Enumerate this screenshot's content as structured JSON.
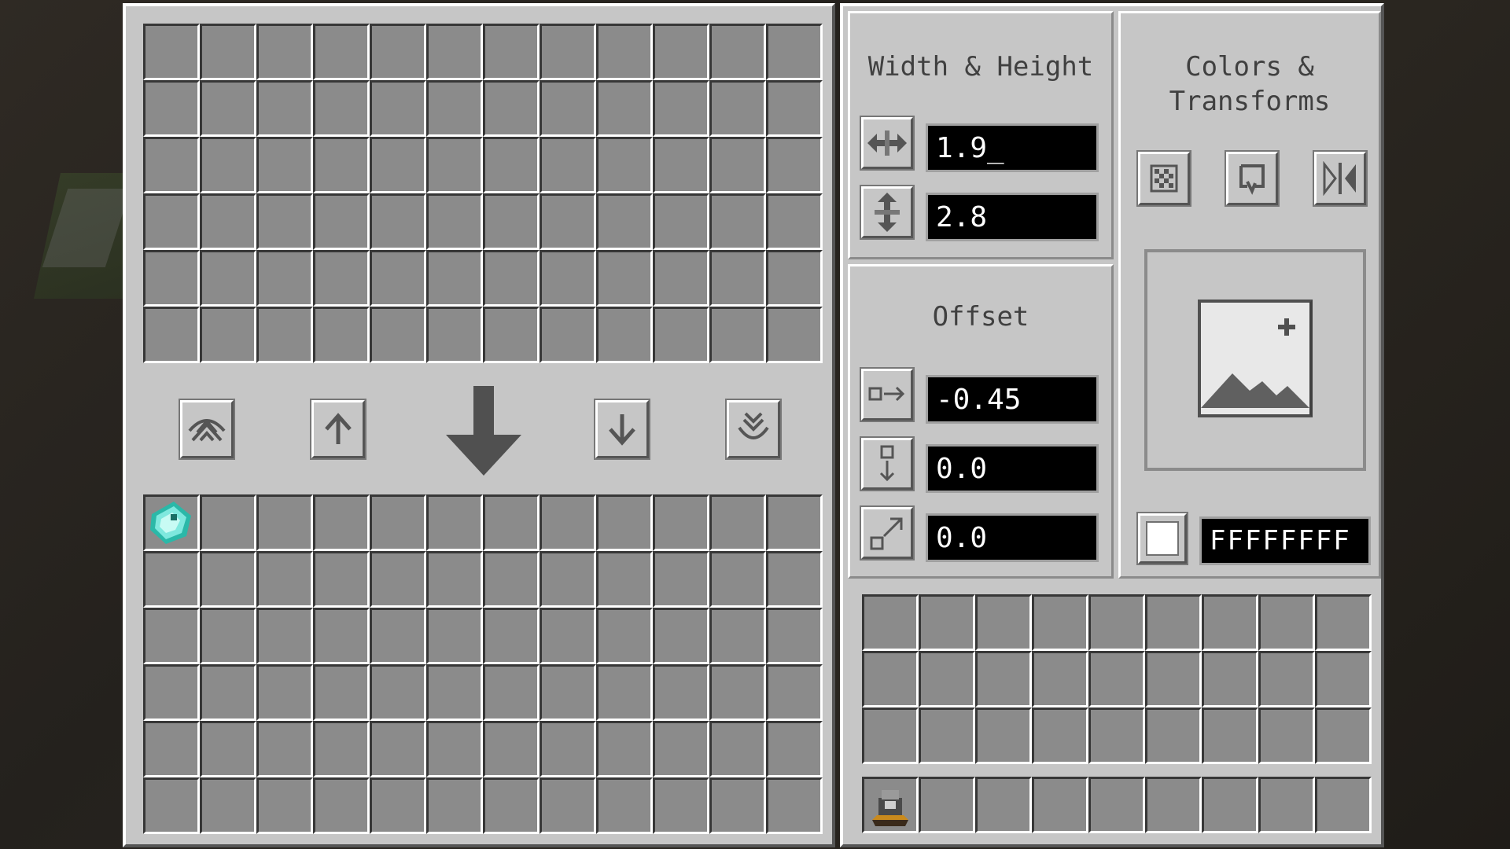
{
  "width_height": {
    "title": "Width & Height",
    "width_value": "1.9_",
    "height_value": "2.8"
  },
  "offset": {
    "title": "Offset",
    "x_value": "-0.45",
    "y_value": "0.0",
    "z_value": "0.0"
  },
  "colors": {
    "title_line1": "Colors &",
    "title_line2": "Transforms",
    "color_hex": "FFFFFFFF",
    "swatch_color": "#ffffff"
  },
  "icons": {
    "move_all_up": "move-all-up-icon",
    "move_up": "arrow-up-icon",
    "transfer": "big-arrow-down-icon",
    "move_down": "arrow-down-icon",
    "move_all_down": "move-all-down-icon",
    "width": "horizontal-resize-icon",
    "height": "vertical-resize-icon",
    "offset_x": "offset-x-icon",
    "offset_y": "offset-y-icon",
    "offset_z": "offset-z-icon",
    "texture": "checker-texture-icon",
    "rotate": "rotate-icon",
    "mirror": "mirror-icon",
    "preview": "image-placeholder-icon"
  },
  "inventory": {
    "top_rows": 6,
    "top_cols": 12,
    "bottom_rows": 6,
    "bottom_cols": 12,
    "player_rows": 3,
    "player_cols": 9,
    "hotbar_cols": 9,
    "item_first_slot": "diamond-item",
    "hotbar_first_slot": "display-block-item"
  }
}
